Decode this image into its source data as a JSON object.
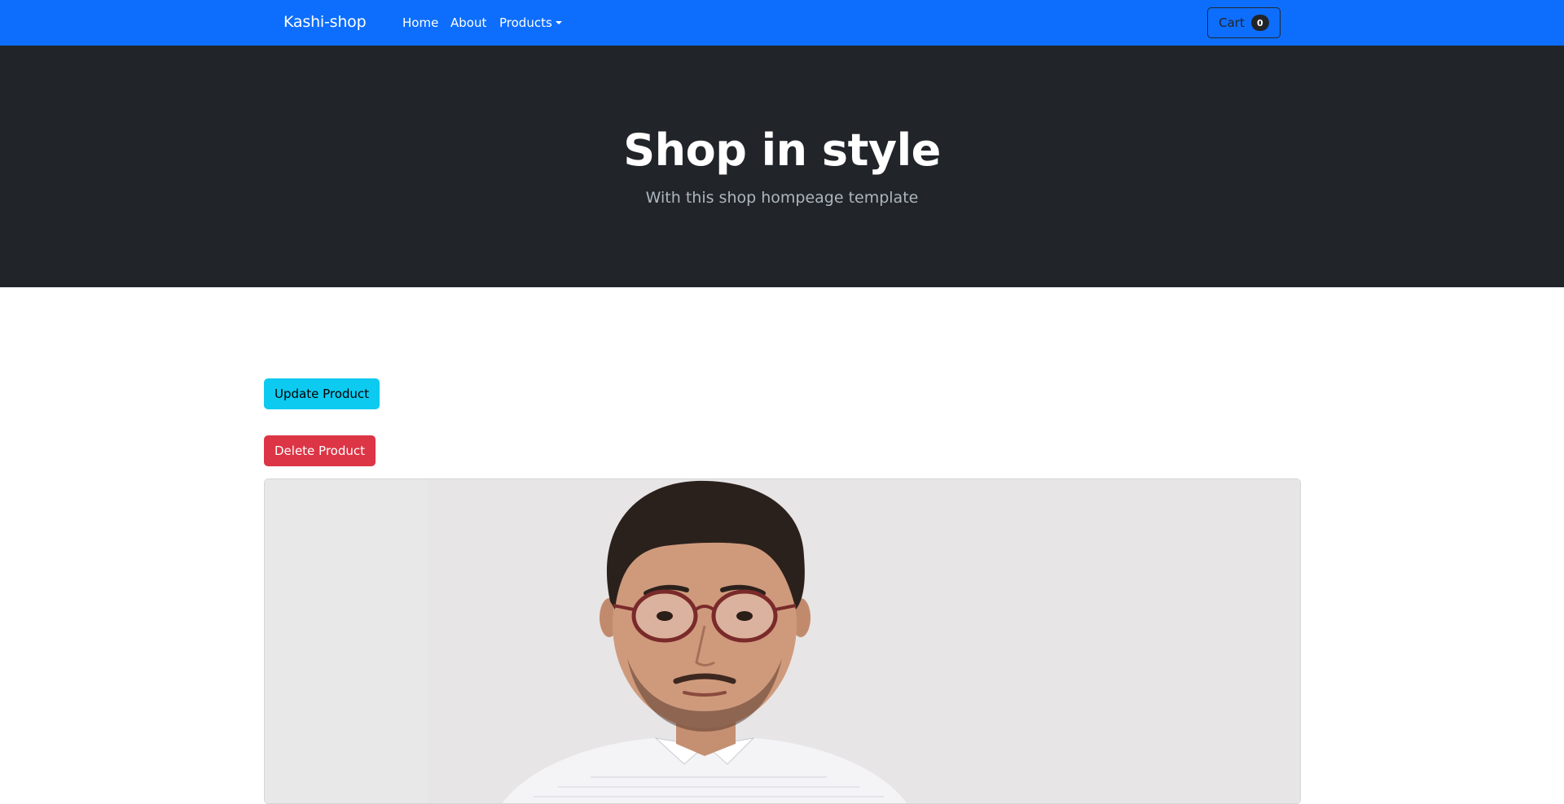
{
  "navbar": {
    "brand": "Kashi-shop",
    "links": [
      {
        "label": "Home"
      },
      {
        "label": "About"
      },
      {
        "label": "Products"
      }
    ],
    "cart": {
      "label": "Cart",
      "count": "0"
    }
  },
  "hero": {
    "title": "Shop in style",
    "subtitle": "With this shop hompeage template"
  },
  "actions": {
    "update_label": "Update Product",
    "delete_label": "Delete Product"
  },
  "product": {
    "image": "portrait photo of a man with glasses in a checked shirt"
  },
  "colors": {
    "primary": "#0d6efd",
    "dark": "#212529",
    "info": "#0dcaf0",
    "danger": "#dc3545"
  }
}
